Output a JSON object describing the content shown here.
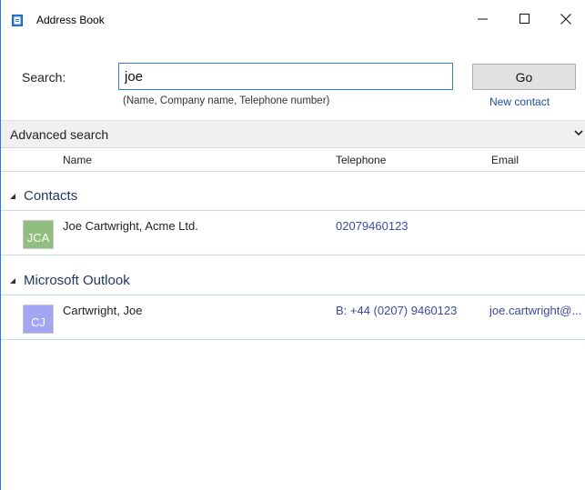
{
  "window": {
    "title": "Address Book",
    "icon": "address-book-icon",
    "controls": [
      "minimize-icon",
      "maximize-icon",
      "close-icon"
    ]
  },
  "search": {
    "label": "Search:",
    "value": "joe",
    "hint": "(Name, Company name, Telephone number)",
    "go_label": "Go",
    "new_contact_label": "New contact"
  },
  "advanced": {
    "label": "Advanced search",
    "icon": "chevron-down-icon"
  },
  "columns": {
    "name": "Name",
    "telephone": "Telephone",
    "email": "Email"
  },
  "groups": [
    {
      "title": "Contacts",
      "rows": [
        {
          "initials": "JCA",
          "avatar_color": "#8fbe7e",
          "name": "Joe Cartwright, Acme Ltd.",
          "telephone": "02079460123",
          "email": ""
        }
      ]
    },
    {
      "title": "Microsoft Outlook",
      "rows": [
        {
          "initials": "CJ",
          "avatar_color": "#a3a6f2",
          "name": "Cartwright, Joe",
          "telephone": "B: +44 (0207) 9460123",
          "email": "joe.cartwright@..."
        }
      ]
    }
  ],
  "colors": {
    "accent": "#2b7ad6",
    "link": "#1f4fa8",
    "group_title": "#1f3864",
    "row_border": "#c6dcef"
  }
}
